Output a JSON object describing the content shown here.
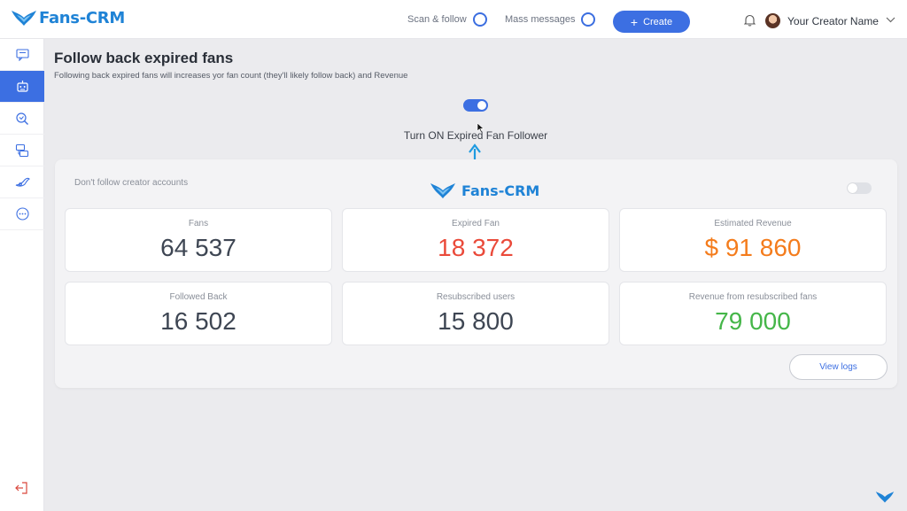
{
  "brand": {
    "name": "Fans-CRM",
    "color": "#1f83d6"
  },
  "topbar": {
    "scan_follow": "Scan & follow",
    "mass_messages": "Mass messages",
    "create_label": "Create",
    "user_name": "Your Creator Name"
  },
  "sidebar": {
    "items": [
      "message-icon",
      "bot-icon",
      "search-icon",
      "layers-icon",
      "wing-icon",
      "more-icon"
    ],
    "active_index": 1,
    "bottom": "logout-icon"
  },
  "page": {
    "title": "Follow back expired fans",
    "subtitle": "Following back expired fans will increases yor fan count (they'll likely follow back) and Revenue",
    "toggle_on": true,
    "toggle_caption": "Turn ON Expired Fan Follower"
  },
  "panel": {
    "option_label": "Don't follow creator accounts",
    "option_on": false,
    "watermark": "Fans-CRM",
    "stats": [
      {
        "label": "Fans",
        "value": "64 537",
        "color": "#3e4653"
      },
      {
        "label": "Expired Fan",
        "value": "18 372",
        "color": "#ea4a3a"
      },
      {
        "label": "Estimated Revenue",
        "value": "$ 91 860",
        "color": "#f47c1c"
      },
      {
        "label": "Followed Back",
        "value": "16 502",
        "color": "#3e4653"
      },
      {
        "label": "Resubscribed users",
        "value": "15 800",
        "color": "#3e4653"
      },
      {
        "label": "Revenue from resubscribed fans",
        "value": "79 000",
        "color": "#45b649"
      }
    ],
    "view_logs": "View logs"
  },
  "colors": {
    "accent": "#3c6fe2"
  }
}
